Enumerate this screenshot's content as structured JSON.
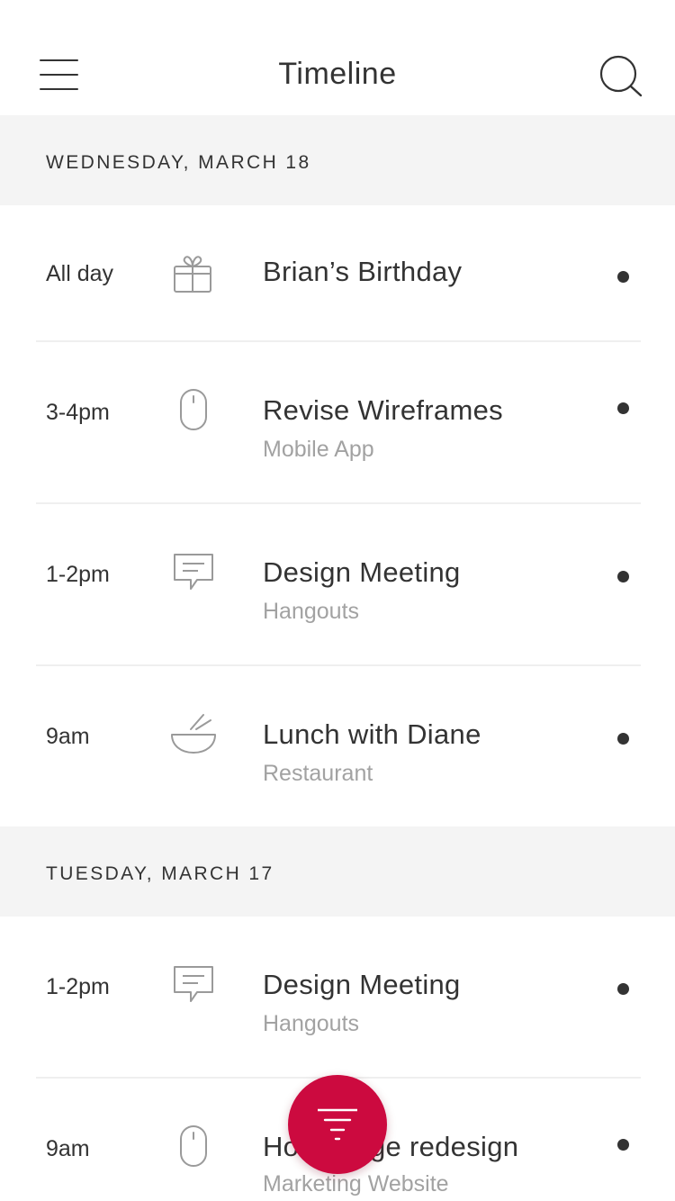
{
  "header": {
    "title": "Timeline",
    "menu_icon": "hamburger-menu-icon",
    "search_icon": "search-icon"
  },
  "sections": [
    {
      "date": "WEDNESDAY, MARCH 18",
      "events": [
        {
          "time": "All day",
          "icon": "gift-icon",
          "title": "Brian’s Birthday",
          "subtitle": ""
        },
        {
          "time": "3-4pm",
          "icon": "mouse-icon",
          "title": "Revise Wireframes",
          "subtitle": "Mobile App"
        },
        {
          "time": "1-2pm",
          "icon": "chat-bubble-icon",
          "title": "Design Meeting",
          "subtitle": "Hangouts"
        },
        {
          "time": "9am",
          "icon": "bowl-chopsticks-icon",
          "title": "Lunch with Diane",
          "subtitle": "Restaurant"
        }
      ]
    },
    {
      "date": "TUESDAY, MARCH 17",
      "events": [
        {
          "time": "1-2pm",
          "icon": "chat-bubble-icon",
          "title": "Design Meeting",
          "subtitle": "Hangouts"
        },
        {
          "time": "9am",
          "icon": "mouse-icon",
          "title": "Homepage redesign",
          "subtitle": "Marketing Website"
        }
      ]
    }
  ],
  "fab": {
    "icon": "filter-icon"
  },
  "colors": {
    "accent": "#cc0a3f",
    "section_bg": "#f4f4f4",
    "text": "#333333",
    "subtext": "#a2a2a2"
  }
}
